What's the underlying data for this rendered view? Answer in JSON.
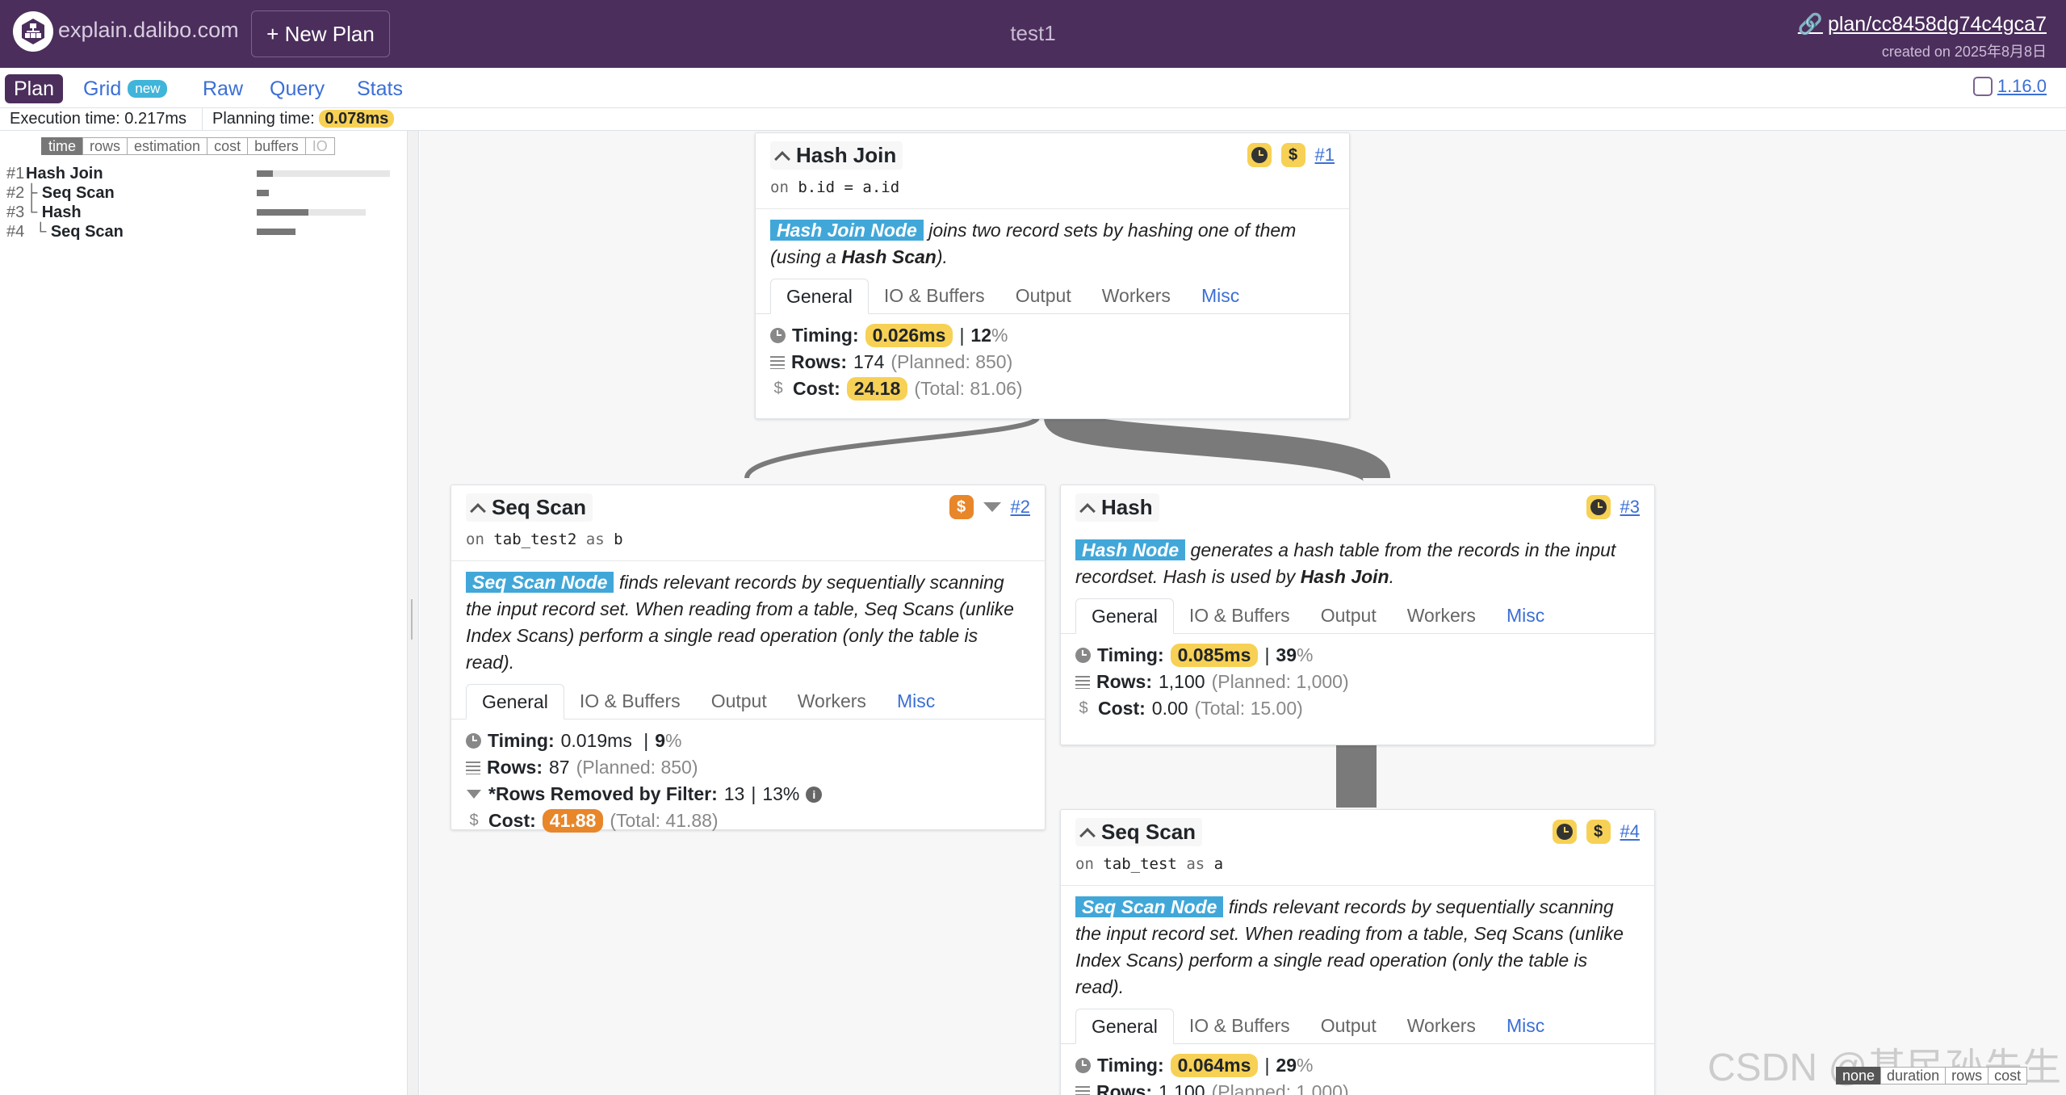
{
  "header": {
    "brand": "explain.dalibo.com",
    "new_plan": "+ New Plan",
    "title": "test1",
    "plan_link": "plan/cc8458dg74c4gca7",
    "created": "created on 2025年8月8日",
    "logo_icon": "dalibo-logo-icon",
    "link_icon": "link-icon"
  },
  "nav": {
    "items": [
      "Plan",
      "Grid",
      "Raw",
      "Query",
      "Stats"
    ],
    "grid_badge": "new",
    "version": "1.16.0"
  },
  "info": {
    "exec_label": "Execution time:",
    "exec_value": "0.217ms",
    "plan_label": "Planning time:",
    "plan_value": "0.078ms"
  },
  "metrics": {
    "tabs": [
      "time",
      "rows",
      "estimation",
      "cost",
      "buffers",
      "IO"
    ],
    "active": "time"
  },
  "tree": [
    {
      "num": "#1",
      "prefix": "",
      "name": "Hash Join",
      "bar": 0.12
    },
    {
      "num": "#2",
      "prefix": "├ ",
      "name": "Seq Scan",
      "bar": 0.09
    },
    {
      "num": "#3",
      "prefix": "└ ",
      "name": "Hash",
      "bar": 0.39
    },
    {
      "num": "#4",
      "prefix": "  └ ",
      "name": "Seq Scan",
      "bar": 0.29
    }
  ],
  "tabs": [
    "General",
    "IO & Buffers",
    "Output",
    "Workers",
    "Misc"
  ],
  "labels": {
    "timing": "Timing:",
    "rows": "Rows:",
    "cost": "Cost:",
    "removed": "*Rows Removed by Filter:"
  },
  "nodes": {
    "n1": {
      "title": "Hash Join",
      "on_kw": "on",
      "cond": "b.id = a.id",
      "id": "#1",
      "tag": "Hash Join Node",
      "desc1": " joins two record sets by hashing one of them (using a ",
      "desc_bold": "Hash Scan",
      "desc2": ").",
      "timing": "0.026ms",
      "timing_pct": "12",
      "rows": "174",
      "planned": "(Planned: 850)",
      "cost": "24.18",
      "total": "(Total: 81.06)"
    },
    "n2": {
      "title": "Seq Scan",
      "on_kw": "on",
      "rel": "tab_test2",
      "as_kw": "as",
      "alias": "b",
      "id": "#2",
      "tag": "Seq Scan Node",
      "desc": " finds relevant records by sequentially scanning the input record set. When reading from a table, Seq Scans (unlike Index Scans) perform a single read operation (only the table is read).",
      "timing": "0.019ms",
      "timing_pct": "9",
      "rows": "87",
      "planned": "(Planned: 850)",
      "removed": "13",
      "removed_pct": "13%",
      "cost": "41.88",
      "total": "(Total: 41.88)"
    },
    "n3": {
      "title": "Hash",
      "id": "#3",
      "tag": "Hash Node",
      "desc1": " generates a hash table from the records in the input recordset. Hash is used by ",
      "desc_bold": "Hash Join",
      "desc2": ".",
      "timing": "0.085ms",
      "timing_pct": "39",
      "rows": "1,100",
      "planned": "(Planned: 1,000)",
      "cost": "0.00",
      "total": "(Total: 15.00)"
    },
    "n4": {
      "title": "Seq Scan",
      "on_kw": "on",
      "rel": "tab_test",
      "as_kw": "as",
      "alias": "a",
      "id": "#4",
      "tag": "Seq Scan Node",
      "desc": " finds relevant records by sequentially scanning the input record set. When reading from a table, Seq Scans (unlike Index Scans) perform a single read operation (only the table is read).",
      "timing": "0.064ms",
      "timing_pct": "29",
      "rows": "1,100",
      "planned": "(Planned: 1,000)"
    }
  },
  "legend": [
    "none",
    "duration",
    "rows",
    "cost"
  ],
  "watermark": "CSDN @基民孙先生",
  "colors": {
    "header": "#4b2e5c",
    "node_tag": "#41a7d9",
    "highlight_yellow": "#f7d155",
    "highlight_orange": "#e8862a",
    "link": "#3b6fd6"
  }
}
